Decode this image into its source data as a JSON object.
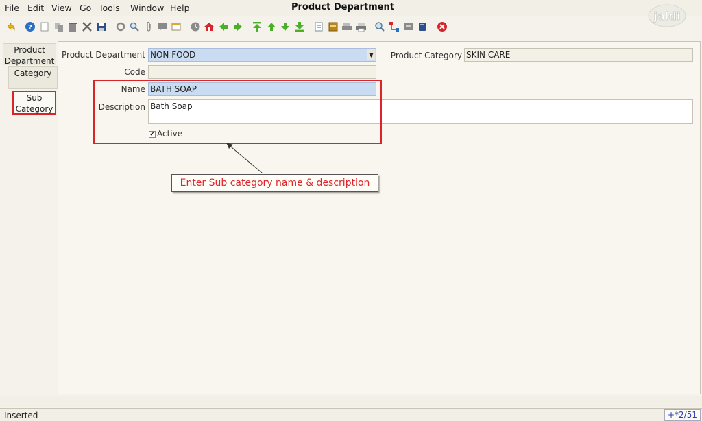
{
  "menu": {
    "file": "File",
    "edit": "Edit",
    "view": "View",
    "go": "Go",
    "tools": "Tools",
    "window": "Window",
    "help": "Help"
  },
  "window_title": "Product Department",
  "logo_text": "jaldi",
  "toolbar": {
    "icons": [
      "undo-icon",
      "help-icon",
      "new-icon",
      "copy-icon",
      "delete-icon",
      "delete-selection-icon",
      "save-icon",
      "refresh-icon",
      "find-icon",
      "attachment-icon",
      "chat-icon",
      "grid-toggle-icon",
      "history-icon",
      "home-icon",
      "back-icon",
      "forward-icon",
      "first-record-icon",
      "previous-record-icon",
      "next-record-icon",
      "last-record-icon",
      "report-icon",
      "archive-icon",
      "print-preview-icon",
      "print-icon",
      "zoom-across-icon",
      "workflow-icon",
      "request-icon",
      "product-info-icon",
      "exit-icon"
    ],
    "colors": {
      "green": "#4caf29",
      "blue": "#2a6fc4",
      "red": "#d6262b",
      "gray": "#7a7a7a"
    }
  },
  "tabs": {
    "product_department": "Product Department",
    "category": "Category",
    "sub_category": "Sub Category"
  },
  "form": {
    "product_department": {
      "label": "Product Department",
      "value": "NON FOOD"
    },
    "product_category": {
      "label": "Product Category",
      "value": "SKIN CARE"
    },
    "code": {
      "label": "Code",
      "value": ""
    },
    "name": {
      "label": "Name",
      "value": "BATH SOAP"
    },
    "description": {
      "label": "Description",
      "value": "Bath Soap"
    },
    "active": {
      "label": "Active",
      "checked": true
    }
  },
  "annotation": {
    "callout_text": "Enter Sub category name & description",
    "highlight_color": "#d9242a"
  },
  "status": {
    "text": "Inserted",
    "record": "+*2/51"
  }
}
